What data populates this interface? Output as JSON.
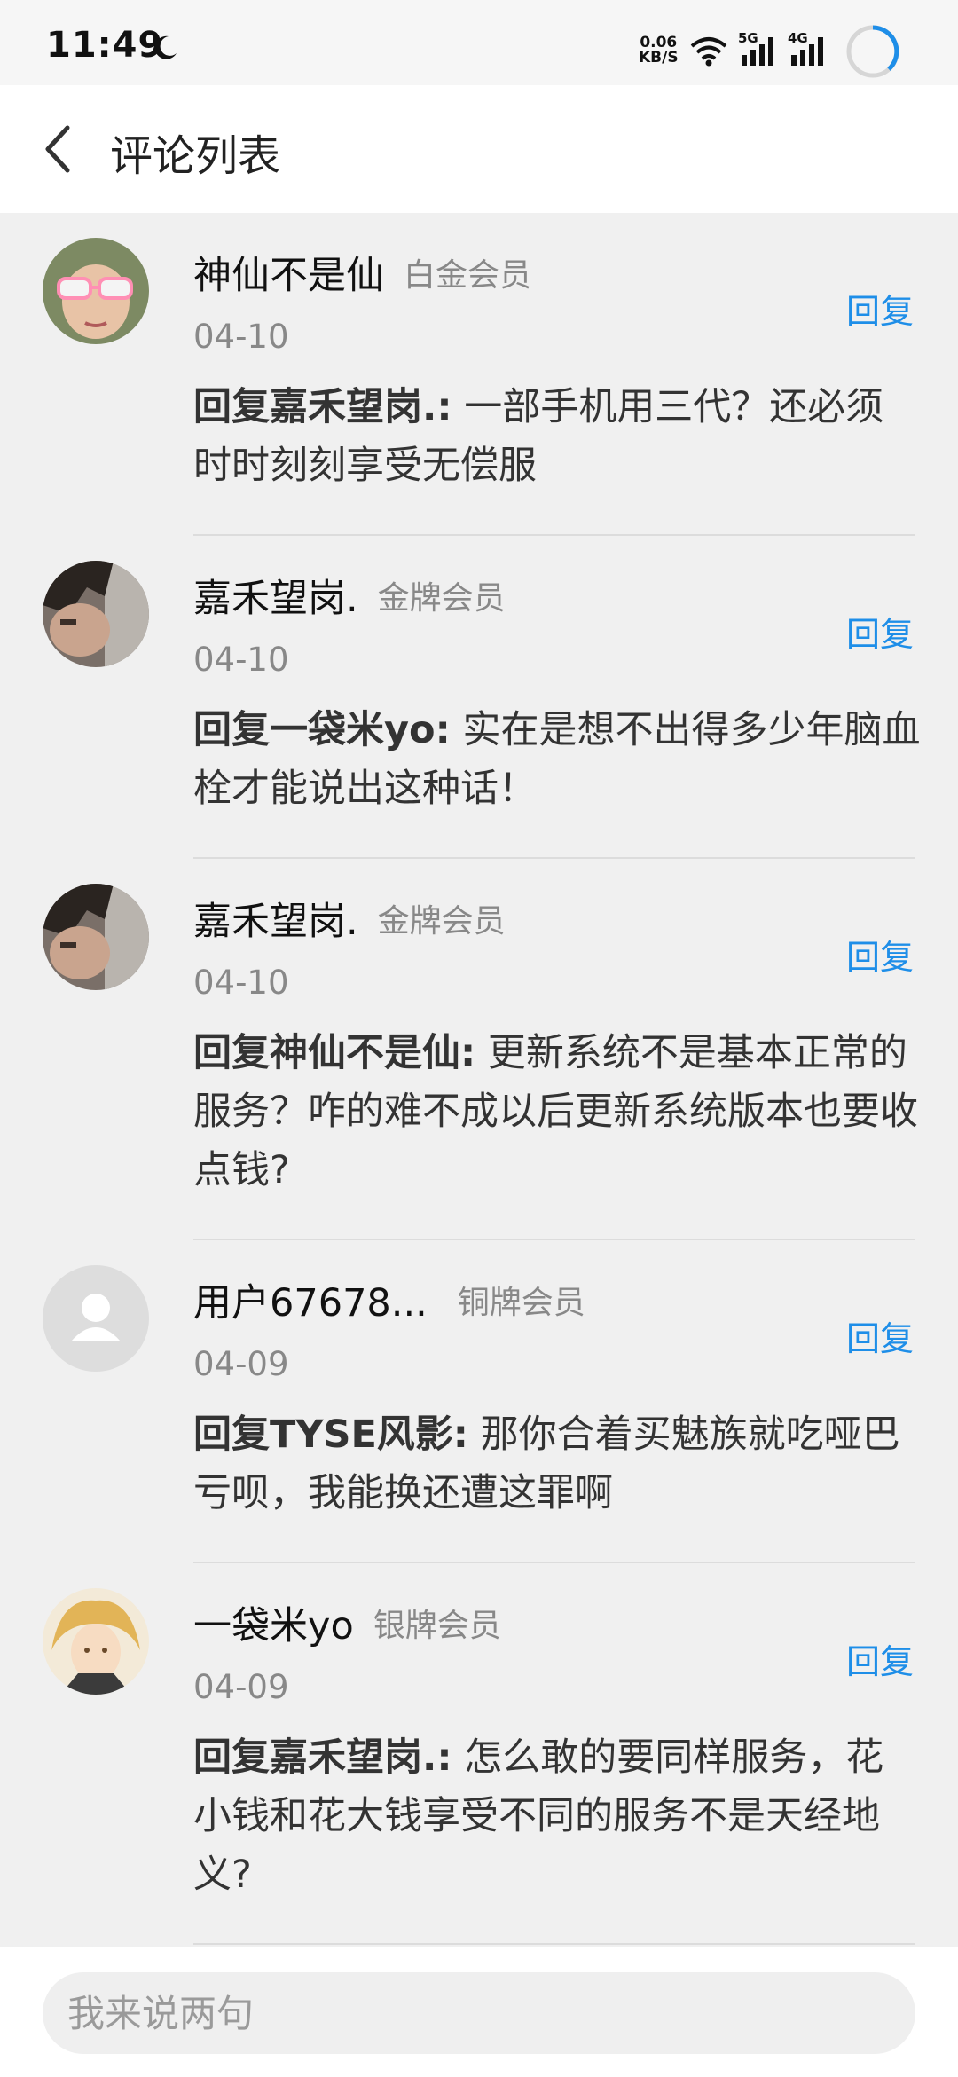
{
  "status_bar": {
    "time": "11:49",
    "net_speed_value": "0.06",
    "net_speed_unit": "KB/S",
    "sig1_label": "5G",
    "sig2_label": "4G",
    "icons": [
      "moon-icon",
      "wifi-icon",
      "signal-icon",
      "signal-icon",
      "loading-ring-icon"
    ]
  },
  "nav": {
    "title": "评论列表",
    "back_icon": "chevron-left-icon"
  },
  "comments": [
    {
      "username": "神仙不是仙",
      "badge": "白金会员",
      "date": "04-10",
      "reply_label": "回复",
      "content_prefix": "回复嘉禾望岗.:",
      "content_text": " 一部手机用三代？还必须时时刻刻享受无偿服"
    },
    {
      "username": "嘉禾望岗.",
      "badge": "金牌会员",
      "date": "04-10",
      "reply_label": "回复",
      "content_prefix": "回复一袋米yo:",
      "content_text": " 实在是想不出得多少年脑血栓才能说出这种话！"
    },
    {
      "username": "嘉禾望岗.",
      "badge": "金牌会员",
      "date": "04-10",
      "reply_label": "回复",
      "content_prefix": "回复神仙不是仙:",
      "content_text": " 更新系统不是基本正常的服务？咋的难不成以后更新系统版本也要收点钱?"
    },
    {
      "username": "用户67678...",
      "badge": "铜牌会员",
      "date": "04-09",
      "reply_label": "回复",
      "content_prefix": "回复TYSE风影:",
      "content_text": " 那你合着买魅族就吃哑巴亏呗，我能换还遭这罪啊"
    },
    {
      "username": "一袋米yo",
      "badge": "银牌会员",
      "date": "04-09",
      "reply_label": "回复",
      "content_prefix": "回复嘉禾望岗.:",
      "content_text": " 怎么敢的要同样服务，花小钱和花大钱享受不同的服务不是天经地义?"
    }
  ],
  "input": {
    "placeholder": "我来说两句"
  },
  "colors": {
    "accent": "#1e8ee8",
    "background": "#f0f0f0",
    "secondary_text": "#888888"
  }
}
